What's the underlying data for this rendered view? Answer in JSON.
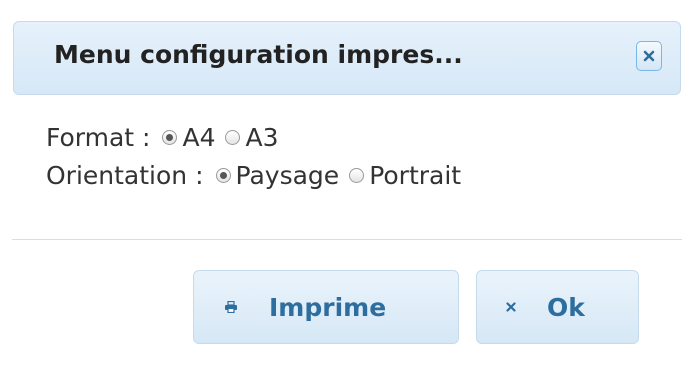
{
  "dialog": {
    "title": "Menu configuration impres...",
    "close_icon": "close-icon"
  },
  "format": {
    "label": "Format :",
    "options": [
      {
        "label": "A4",
        "selected": true
      },
      {
        "label": "A3",
        "selected": false
      }
    ]
  },
  "orientation": {
    "label": "Orientation :",
    "options": [
      {
        "label": "Paysage",
        "selected": true
      },
      {
        "label": "Portrait",
        "selected": false
      }
    ]
  },
  "buttons": {
    "imprime": {
      "label": "Imprime",
      "icon": "print-icon"
    },
    "ok": {
      "label": "Ok",
      "icon": "close-icon"
    }
  },
  "colors": {
    "title_bar": "#d6e8f7",
    "button_text": "#2e6e9e",
    "border": "#c5dbec"
  }
}
